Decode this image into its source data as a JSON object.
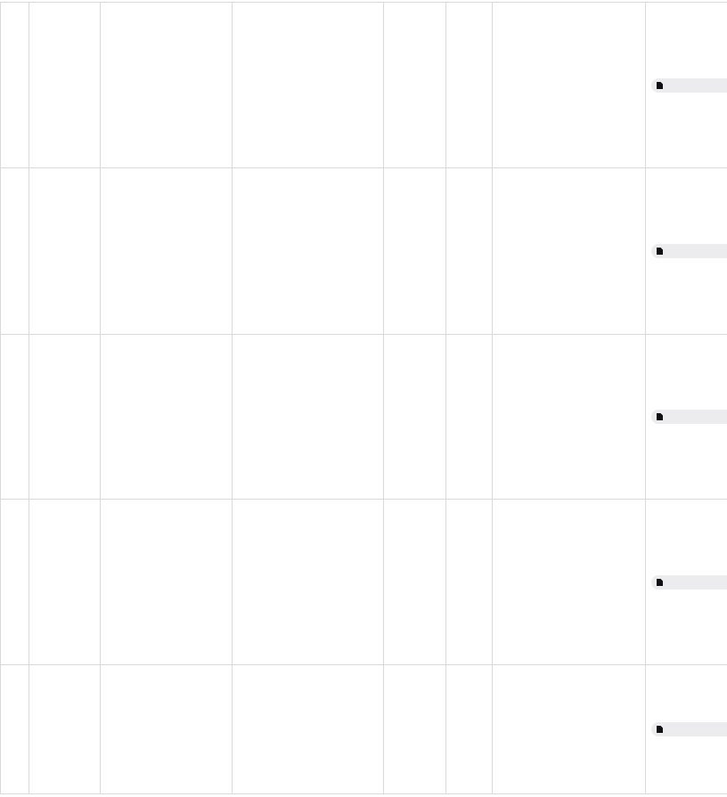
{
  "table": {
    "columns": [
      "",
      "",
      "",
      "",
      "",
      "",
      "",
      ""
    ],
    "rows": [
      {
        "cells": [
          "",
          "",
          "",
          "",
          "",
          "",
          ""
        ],
        "attachment": {
          "icon": "file-icon",
          "label": ""
        }
      },
      {
        "cells": [
          "",
          "",
          "",
          "",
          "",
          "",
          ""
        ],
        "attachment": {
          "icon": "file-icon",
          "label": ""
        }
      },
      {
        "cells": [
          "",
          "",
          "",
          "",
          "",
          "",
          ""
        ],
        "attachment": {
          "icon": "file-icon",
          "label": ""
        }
      },
      {
        "cells": [
          "",
          "",
          "",
          "",
          "",
          "",
          ""
        ],
        "attachment": {
          "icon": "file-icon",
          "label": ""
        }
      },
      {
        "cells": [
          "",
          "",
          "",
          "",
          "",
          "",
          ""
        ],
        "attachment": {
          "icon": "file-icon",
          "label": ""
        }
      }
    ]
  },
  "colors": {
    "grid_line": "#d9d9d9",
    "chip_background": "#ececef",
    "icon": "#111111"
  }
}
